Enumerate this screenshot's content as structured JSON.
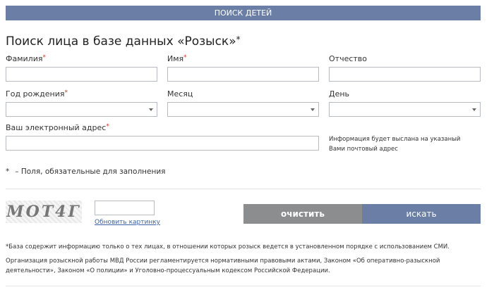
{
  "header": {
    "title": "ПОИСК ДЕТЕЙ"
  },
  "form": {
    "heading": "Поиск лица в базе данных «Розыск»",
    "heading_mark": "*",
    "lastname": {
      "label": "Фамилия",
      "value": ""
    },
    "firstname": {
      "label": "Имя",
      "value": ""
    },
    "patronymic": {
      "label": "Отчество",
      "value": ""
    },
    "birth_year": {
      "label": "Год рождения",
      "selected": ""
    },
    "month": {
      "label": "Месяц",
      "selected": ""
    },
    "day": {
      "label": "День",
      "selected": ""
    },
    "email": {
      "label": "Ваш электронный адрес",
      "value": ""
    },
    "email_hint": "Информация будет выслана на указаный Вами почтовый адрес",
    "required_star": "*",
    "required_note": "– Поля, обязательные для заполнения"
  },
  "captcha": {
    "image_text": "МОТ4Г",
    "input_value": "",
    "refresh_label": "Обновить картинку"
  },
  "buttons": {
    "clear": "очистить",
    "search": "искать"
  },
  "notes": {
    "db_note": "*База содержит информацию только о тех лицах, в отношении которых розыск ведется в установленном порядке с использованием СМИ.",
    "legal_note": "Организация розыскной работы МВД России регламентируется нормативными правовыми актами, Законом «Об оперативно-разыскной деятельности», Законом «О полиции» и Уголовно-процессуальным кодексом Российской Федерации."
  },
  "colors": {
    "accent": "#6b7fa6",
    "clear_button": "#8b8d8f",
    "required": "#c0392b",
    "link": "#3b62a5"
  }
}
